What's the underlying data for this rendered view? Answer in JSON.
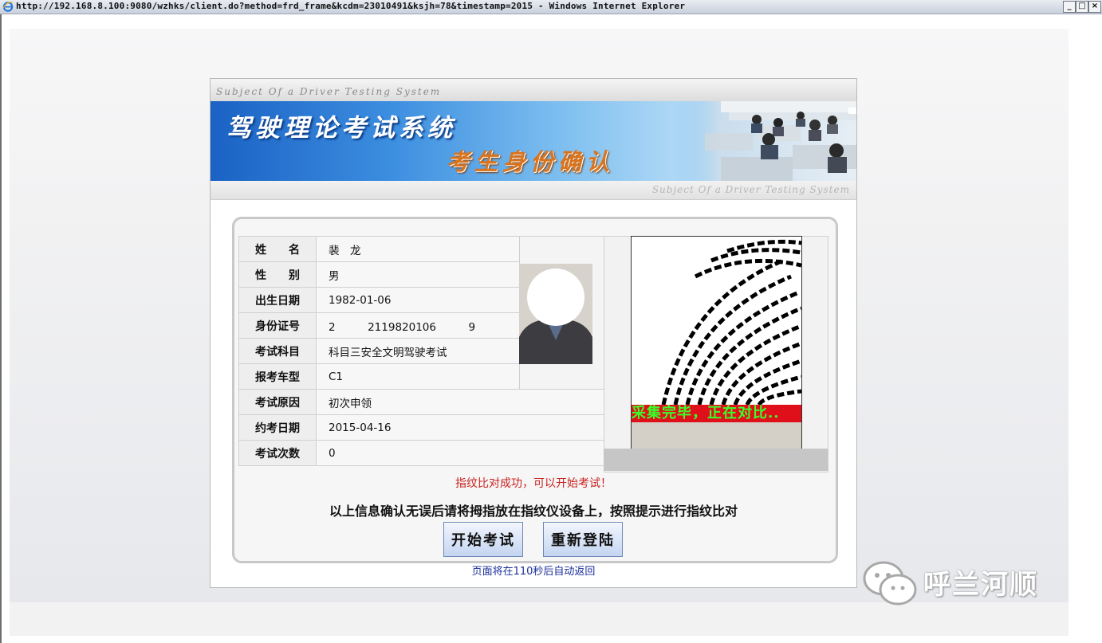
{
  "window": {
    "title": "http://192.168.8.100:9080/wzhks/client.do?method=frd_frame&kcdm=23010491&ksjh=78&timestamp=2015 - Windows Internet Explorer",
    "buttons": [
      "_",
      "□",
      "×"
    ]
  },
  "header": {
    "top_strip": "Subject Of a Driver Testing System",
    "title": "驾驶理论考试系统",
    "subtitle": "考生身份确认",
    "bottom_strip": "Subject Of a Driver Testing System"
  },
  "candidate": {
    "rows": [
      {
        "label": "姓　　名",
        "value": "裴　龙"
      },
      {
        "label": "性　　别",
        "value": "男"
      },
      {
        "label": "出生日期",
        "value": "1982-01-06"
      },
      {
        "label": "身份证号",
        "value": "2　　　2119820106　　　9"
      },
      {
        "label": "考试科目",
        "value": "科目三安全文明驾驶考试"
      },
      {
        "label": "报考车型",
        "value": "C1"
      },
      {
        "label": "考试原因",
        "value": "初次申领"
      },
      {
        "label": "约考日期",
        "value": "2015-04-16"
      },
      {
        "label": "考试次数",
        "value": "0"
      }
    ]
  },
  "fingerprint": {
    "status": "采集完毕，正在对比.."
  },
  "messages": {
    "success": "指纹比对成功，可以开始考试！",
    "instruction": "以上信息确认无误后请将拇指放在指纹仪设备上，按照提示进行指纹比对",
    "return": "页面将在110秒后自动返回"
  },
  "actions": {
    "start": "开始考试",
    "relogin": "重新登陆"
  },
  "watermark": {
    "text": "呼兰河顺"
  },
  "colors": {
    "banner_blue": "#1a62c4",
    "subtitle_orange": "#d9731c",
    "success_red": "#c8231f",
    "status_bar_red": "#e0101a",
    "status_text_green": "#37ff2a",
    "return_blue": "#1b2e9a"
  }
}
